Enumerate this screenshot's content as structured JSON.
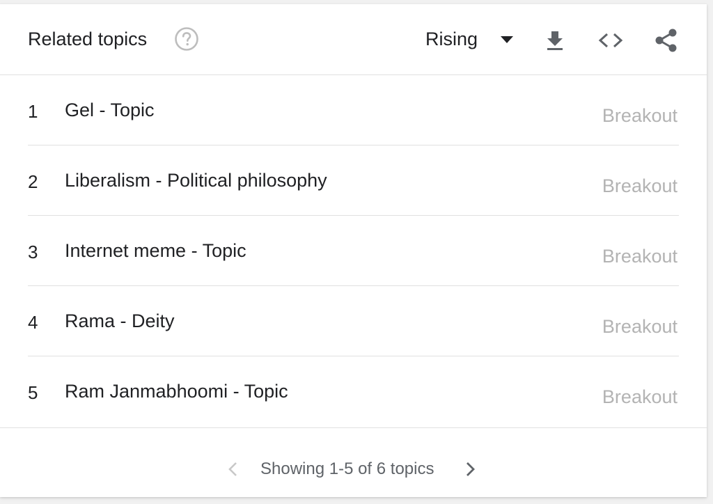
{
  "header": {
    "title": "Related topics",
    "sort_label": "Rising"
  },
  "icons": {
    "help": "help-circle-icon",
    "sort_caret": "caret-down-icon",
    "download": "download-icon",
    "embed": "embed-code-icon",
    "share": "share-icon",
    "prev": "chevron-left-icon",
    "next": "chevron-right-icon"
  },
  "topics": [
    {
      "rank": "1",
      "label": "Gel - Topic",
      "value": "Breakout"
    },
    {
      "rank": "2",
      "label": "Liberalism - Political philosophy",
      "value": "Breakout"
    },
    {
      "rank": "3",
      "label": "Internet meme - Topic",
      "value": "Breakout"
    },
    {
      "rank": "4",
      "label": "Rama - Deity",
      "value": "Breakout"
    },
    {
      "rank": "5",
      "label": "Ram Janmabhoomi - Topic",
      "value": "Breakout"
    }
  ],
  "footer": {
    "page_info": "Showing 1-5 of 6 topics"
  },
  "colors": {
    "text_primary": "#202124",
    "text_value": "#b3b3b3",
    "icon": "#5f6368",
    "icon_disabled": "#c8c8c8",
    "divider": "#e0e0e0"
  }
}
